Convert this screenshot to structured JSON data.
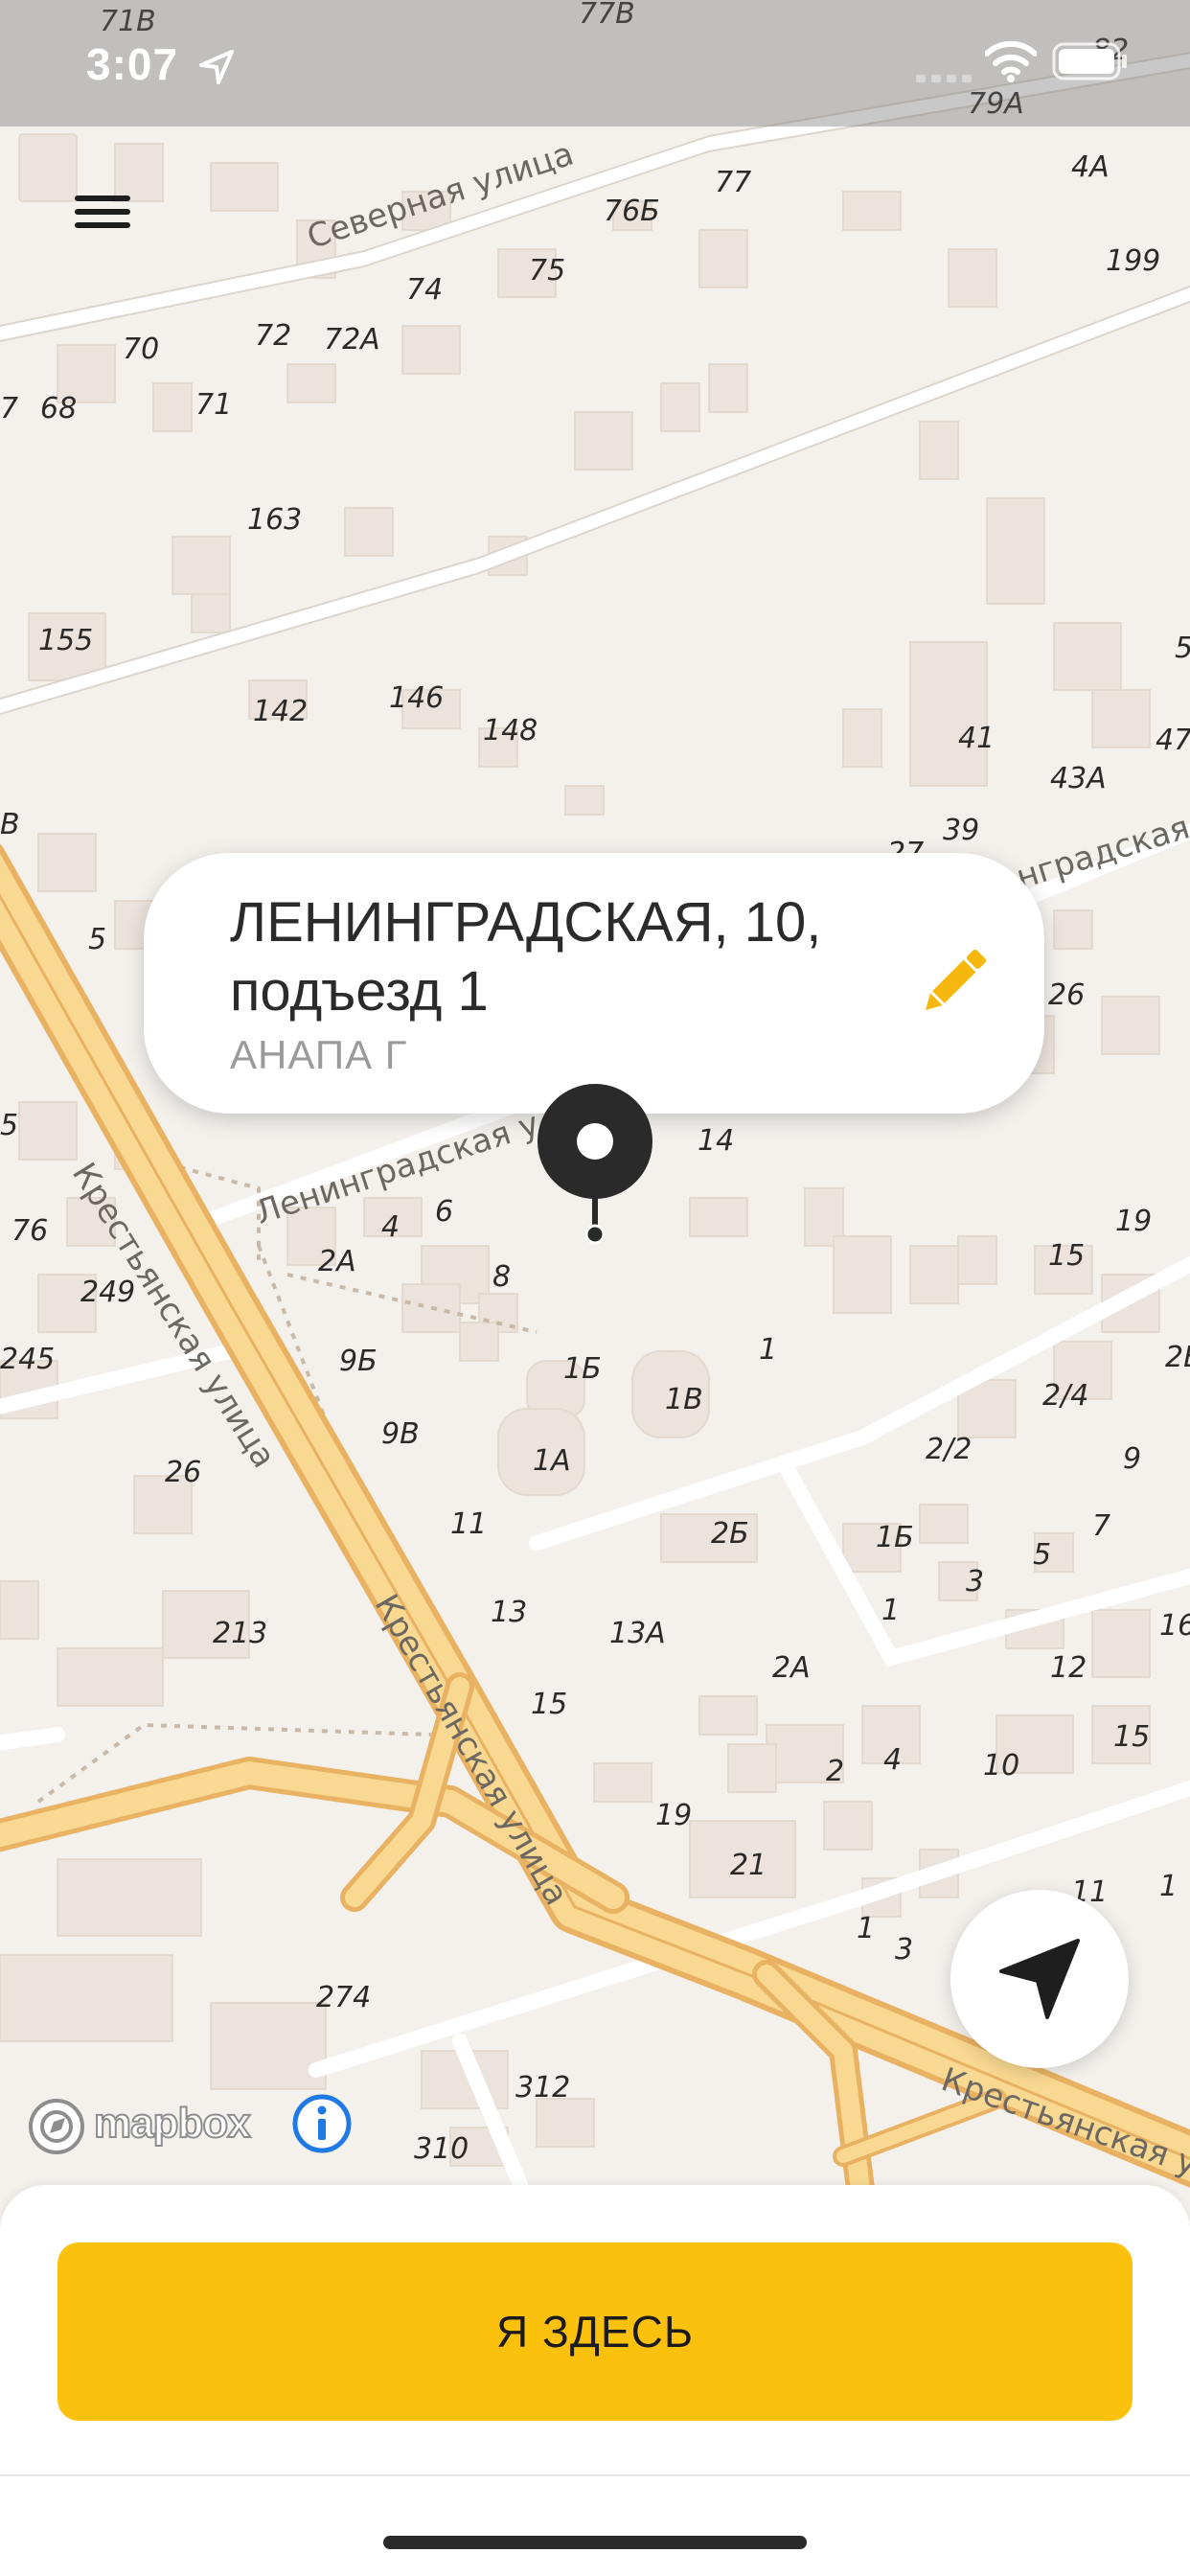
{
  "status_bar": {
    "time": "3:07",
    "location_icon": "location-arrow-icon",
    "signal_icon": "cellular-signal-icon",
    "wifi_icon": "wifi-icon",
    "battery_icon": "battery-icon"
  },
  "menu": {
    "icon": "hamburger-menu-icon"
  },
  "map": {
    "streets": [
      "Северная улица",
      "Ленинградская у",
      "Крестьянская улица",
      "Крестьянская улица",
      "Крестьянская у",
      "нградская"
    ],
    "building_numbers": [
      "71В",
      "77В",
      "79А",
      "82",
      "77",
      "4А",
      "76Б",
      "199",
      "75",
      "74",
      "72",
      "72А",
      "70",
      "68",
      "71",
      "7",
      "163",
      "155",
      "5",
      "142",
      "146",
      "148",
      "41",
      "47",
      "43А",
      "39",
      "27",
      "В",
      "5",
      "26",
      "5",
      "14",
      "4",
      "6",
      "2А",
      "8",
      "76",
      "249",
      "245",
      "19",
      "15",
      "1",
      "9Б",
      "1Б",
      "1В",
      "2Б",
      "2/4",
      "9В",
      "2/2",
      "9",
      "1А",
      "26",
      "11",
      "2Б",
      "1Б",
      "7",
      "3",
      "5",
      "1",
      "16",
      "13",
      "213",
      "13А",
      "2А",
      "12",
      "15",
      "15",
      "2",
      "4",
      "10",
      "19",
      "21",
      "11",
      "1",
      "1",
      "3",
      "274",
      "312",
      "310"
    ]
  },
  "address": {
    "line1": "ЛЕНИНГРАДСКАЯ, 10,",
    "line2": "подъезд 1",
    "city": "АНАПА Г",
    "edit_icon": "pencil-icon"
  },
  "pin": {
    "icon": "map-pin-icon"
  },
  "locate": {
    "icon": "navigation-arrow-icon"
  },
  "attribution": {
    "logo_text": "mapbox",
    "logo_icon": "mapbox-logo-icon",
    "info_icon": "info-icon"
  },
  "confirm": {
    "label": "Я ЗДЕСЬ"
  },
  "colors": {
    "accent": "#fcc10c",
    "road_major": "#f9d891",
    "road_major_edge": "#e9b262",
    "building": "#ece4dc",
    "map_bg": "#f4f1ed",
    "edit_icon": "#f6b80f",
    "info_icon": "#1f7ae6"
  }
}
